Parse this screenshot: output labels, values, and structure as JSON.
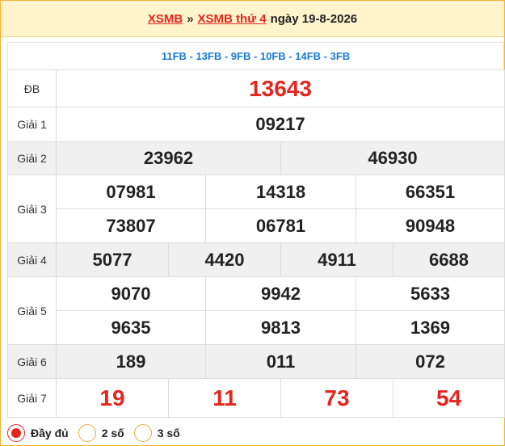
{
  "header": {
    "link1": "XSMB",
    "separator": "»",
    "link2": "XSMB thứ 4",
    "date_text": "ngày 19-8-2026"
  },
  "codes": "11FB - 13FB - 9FB - 10FB - 14FB - 3FB",
  "prizes": {
    "db": {
      "label": "ĐB",
      "numbers": [
        "13643"
      ]
    },
    "g1": {
      "label": "Giải 1",
      "numbers": [
        "09217"
      ]
    },
    "g2": {
      "label": "Giải 2",
      "numbers": [
        "23962",
        "46930"
      ]
    },
    "g3": {
      "label": "Giải 3",
      "numbers": [
        "07981",
        "14318",
        "66351",
        "73807",
        "06781",
        "90948"
      ]
    },
    "g4": {
      "label": "Giải 4",
      "numbers": [
        "5077",
        "4420",
        "4911",
        "6688"
      ]
    },
    "g5": {
      "label": "Giải 5",
      "numbers": [
        "9070",
        "9942",
        "5633",
        "9635",
        "9813",
        "1369"
      ]
    },
    "g6": {
      "label": "Giải 6",
      "numbers": [
        "189",
        "011",
        "072"
      ]
    },
    "g7": {
      "label": "Giải 7",
      "numbers": [
        "19",
        "11",
        "73",
        "54"
      ]
    }
  },
  "footer": {
    "options": [
      "Đầy đủ",
      "2 số",
      "3 số"
    ],
    "selected": "Đầy đủ"
  },
  "colors": {
    "accent_red": "#e4261f",
    "code_blue": "#1a7bd3",
    "header_bg": "#fff4cc",
    "border": "#f2b233"
  }
}
